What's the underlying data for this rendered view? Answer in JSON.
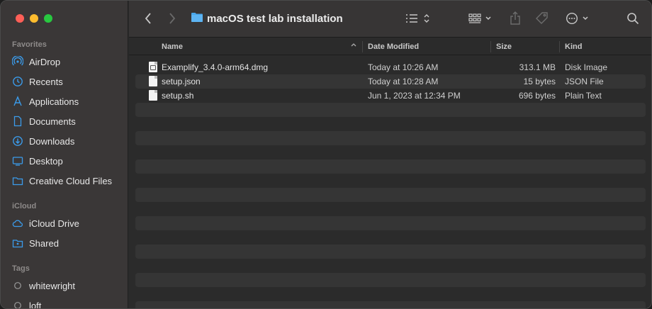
{
  "window": {
    "title": "macOS test lab installation"
  },
  "sidebar": {
    "favorites_label": "Favorites",
    "favorites": [
      {
        "label": "AirDrop",
        "icon": "airdrop-icon"
      },
      {
        "label": "Recents",
        "icon": "clock-icon"
      },
      {
        "label": "Applications",
        "icon": "applications-icon"
      },
      {
        "label": "Documents",
        "icon": "document-icon"
      },
      {
        "label": "Downloads",
        "icon": "download-icon"
      },
      {
        "label": "Desktop",
        "icon": "desktop-icon"
      },
      {
        "label": "Creative Cloud Files",
        "icon": "folder-icon"
      }
    ],
    "icloud_label": "iCloud",
    "icloud": [
      {
        "label": "iCloud Drive",
        "icon": "cloud-icon"
      },
      {
        "label": "Shared",
        "icon": "shared-folder-icon"
      }
    ],
    "tags_label": "Tags",
    "tags": [
      {
        "label": "whitewright",
        "icon": "tag-circle-icon"
      },
      {
        "label": "loft",
        "icon": "tag-circle-icon"
      }
    ]
  },
  "columns": {
    "name": "Name",
    "date": "Date Modified",
    "size": "Size",
    "kind": "Kind"
  },
  "files": [
    {
      "name": "Examplify_3.4.0-arm64.dmg",
      "date": "Today at 10:26 AM",
      "size": "313.1 MB",
      "kind": "Disk Image"
    },
    {
      "name": "setup.json",
      "date": "Today at 10:28 AM",
      "size": "15 bytes",
      "kind": "JSON File"
    },
    {
      "name": "setup.sh",
      "date": "Jun 1, 2023 at 12:34 PM",
      "size": "696 bytes",
      "kind": "Plain Text"
    }
  ],
  "colors": {
    "accent": "#3b9bea",
    "sidebar_bg": "#3a3737",
    "content_bg": "#2b2b2b"
  }
}
